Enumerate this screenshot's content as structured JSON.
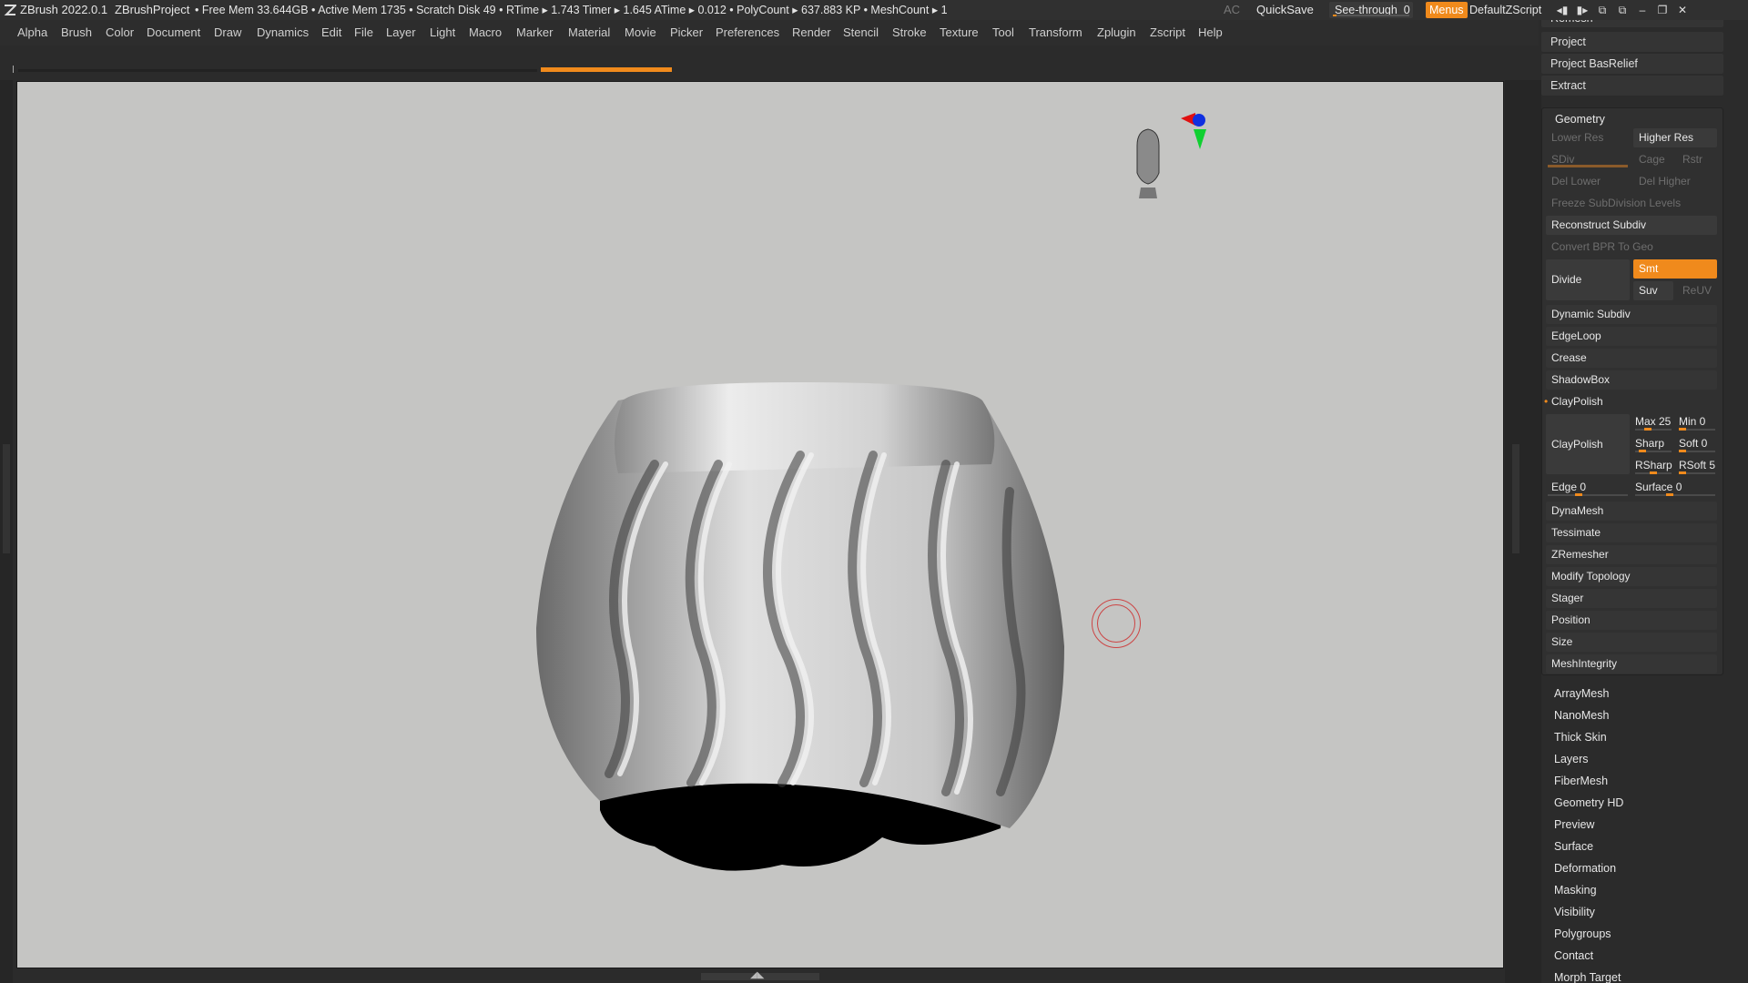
{
  "titlebar": {
    "app": "ZBrush 2022.0.1",
    "project": "ZBrushProject",
    "stats": "• Free Mem 33.644GB • Active Mem 1735 • Scratch Disk 49 • RTime ▸ 1.743 Timer ▸ 1.645 ATime ▸ 0.012 • PolyCount ▸ 637.883 KP • MeshCount ▸ 1",
    "ac": "AC",
    "quicksave": "QuickSave",
    "seethrough_label": "See-through",
    "seethrough_value": "0",
    "seethrough_level": 0.05,
    "menus": "Menus",
    "script": "DefaultZScript"
  },
  "menu": [
    "Alpha",
    "Brush",
    "Color",
    "Document",
    "Draw",
    "Dynamics",
    "Edit",
    "File",
    "Layer",
    "Light",
    "Macro",
    "Marker",
    "Material",
    "Movie",
    "Picker",
    "Preferences",
    "Render",
    "Stencil",
    "Stroke",
    "Texture",
    "Tool",
    "Transform",
    "Zplugin",
    "Zscript",
    "Help"
  ],
  "panel": {
    "top_buttons": [
      "Remesh",
      "Project",
      "Project BasRelief",
      "Extract"
    ],
    "geometry": {
      "title": "Geometry",
      "lower_res": "Lower Res",
      "higher_res": "Higher Res",
      "sdiv": "SDiv",
      "cage": "Cage",
      "rstr": "Rstr",
      "del_lower": "Del Lower",
      "del_higher": "Del Higher",
      "freeze": "Freeze SubDivision Levels",
      "reconstruct": "Reconstruct Subdiv",
      "convert": "Convert BPR To Geo",
      "divide": "Divide",
      "smt": "Smt",
      "suv": "Suv",
      "reuv": "ReUV",
      "dynamic_subdiv": "Dynamic Subdiv",
      "edgeloop": "EdgeLoop",
      "crease": "Crease",
      "shadowbox": "ShadowBox",
      "claypolish_header": "ClayPolish",
      "claypolish_btn": "ClayPolish",
      "max": "Max 25",
      "min": "Min 0",
      "sharp": "Sharp",
      "soft": "Soft 0",
      "rsharp": "RSharp",
      "rsoft": "RSoft 5",
      "edge": "Edge 0",
      "surface": "Surface 0",
      "dynamesh": "DynaMesh",
      "tessimate": "Tessimate",
      "zremesher": "ZRemesher",
      "modify_topology": "Modify Topology",
      "stager": "Stager",
      "position": "Position",
      "size": "Size",
      "meshintegrity": "MeshIntegrity"
    },
    "subpalettes": [
      "ArrayMesh",
      "NanoMesh",
      "Thick Skin",
      "Layers",
      "FiberMesh",
      "Geometry HD",
      "Preview",
      "Surface",
      "Deformation",
      "Masking",
      "Visibility",
      "Polygroups",
      "Contact",
      "Morph Target"
    ]
  },
  "colors": {
    "accent": "#f08a1c",
    "viewport_bg": "#c5c5c3",
    "ui_bg": "#2b2b2b"
  }
}
